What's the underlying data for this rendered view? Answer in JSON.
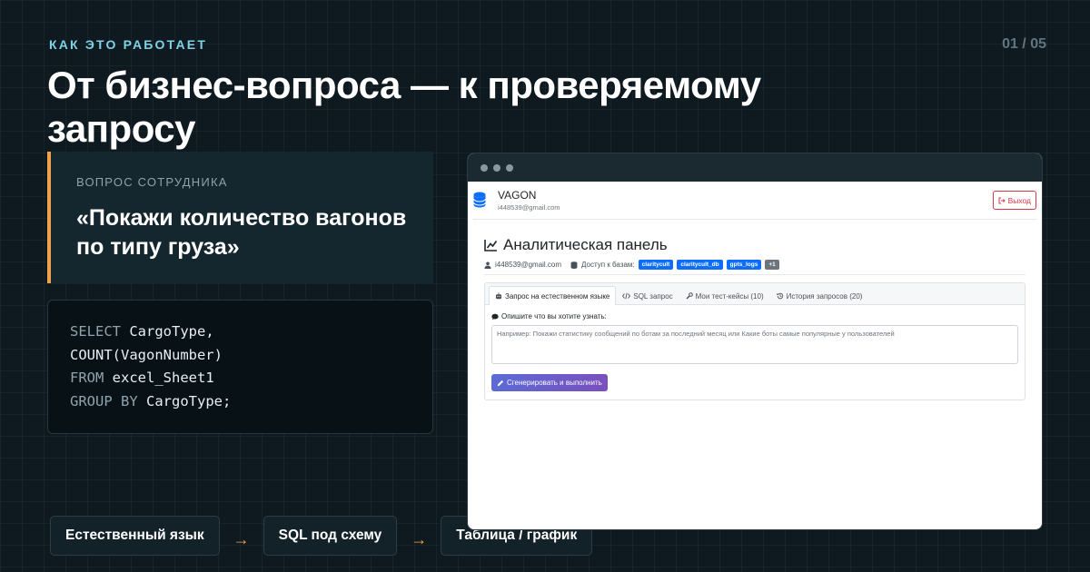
{
  "slide": {
    "eyebrow": "КАК ЭТО РАБОТАЕТ",
    "counter": "01 / 05",
    "title": "От бизнес-вопроса — к проверяемому запросу"
  },
  "question": {
    "label": "ВОПРОС СОТРУДНИКА",
    "text": "«Покажи количество вагонов по типу груза»"
  },
  "sql": {
    "line1_kw": "SELECT",
    "line1_id": "CargoType,",
    "line2_id": "COUNT(VagonNumber)",
    "line3_kw": "FROM",
    "line3_id": "excel_Sheet1",
    "line4_kw": "GROUP BY",
    "line4_id": "CargoType;"
  },
  "flow": {
    "step1": "Естественный язык",
    "step2": "SQL под схему",
    "step3": "Таблица / график",
    "arrow": "→"
  },
  "app": {
    "brand": " VAGON",
    "brand_icon": "database-icon",
    "email": "i448539@gmail.com",
    "logout_label": "Выход",
    "panel_title": "Аналитическая панель",
    "meta_email": "i448539@gmail.com",
    "access_label": "Доступ к базам:",
    "badges": [
      "claritycult",
      "claritycult_db",
      "gpts_logs",
      "+1"
    ],
    "tabs": [
      {
        "label": "Запрос на естественном языке",
        "icon": "robot-icon",
        "active": true
      },
      {
        "label": "SQL запрос",
        "icon": "code-icon",
        "active": false
      },
      {
        "label": "Мои тест-кейсы (10)",
        "icon": "wrench-icon",
        "active": false
      },
      {
        "label": "История запросов (20)",
        "icon": "history-icon",
        "active": false
      }
    ],
    "prompt_label": "Опишите что вы хотите узнать:",
    "textarea_placeholder": "Например: Покажи статистику сообщений по ботам за последний месяц или Какие боты самые популярные у пользователей",
    "generate_label": "Сгенерировать и выполнить"
  },
  "colors": {
    "background": "#0e1a20",
    "accent_orange": "#f0a24a",
    "accent_cyan": "#7fd3e6",
    "badge_blue": "#0d6efd",
    "danger": "#dc3545"
  }
}
